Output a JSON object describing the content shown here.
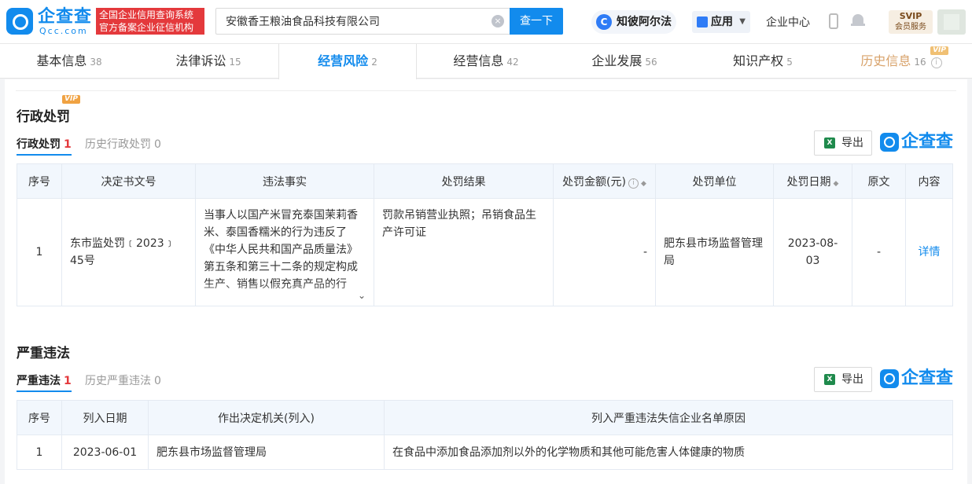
{
  "header": {
    "logo_name": "企查查",
    "logo_domain": "Qcc.com",
    "badge_line1": "全国企业信用查询系统",
    "badge_line2": "官方备案企业征信机构",
    "search_value": "安徽香王粮油食品科技有限公司",
    "search_button": "查一下",
    "zhibi_label": "知彼阿尔法",
    "zhibi_icon_text": "C",
    "apps_label": "应用",
    "enterprise_center": "企业中心",
    "svip_line1": "SVIP",
    "svip_line2": "会员服务"
  },
  "tabs": [
    {
      "label": "基本信息",
      "count": "38"
    },
    {
      "label": "法律诉讼",
      "count": "15"
    },
    {
      "label": "经营风险",
      "count": "2"
    },
    {
      "label": "经营信息",
      "count": "42"
    },
    {
      "label": "企业发展",
      "count": "56"
    },
    {
      "label": "知识产权",
      "count": "5"
    },
    {
      "label": "历史信息",
      "count": "16",
      "badge": "VIP"
    }
  ],
  "admin_penalty": {
    "title": "行政处罚",
    "vip": "VIP",
    "subtab_active": "行政处罚",
    "subtab_active_count": "1",
    "subtab_other": "历史行政处罚",
    "subtab_other_count": "0",
    "export_label": "导出",
    "brand": "企查查",
    "columns": [
      "序号",
      "决定书文号",
      "违法事实",
      "处罚结果",
      "处罚金额(元)",
      "处罚单位",
      "处罚日期",
      "原文",
      "内容"
    ],
    "rows": [
      {
        "index": "1",
        "doc_no": "东市监处罚﹝2023﹞45号",
        "facts": "当事人以国产米冒充泰国茉莉香米、泰国香糯米的行为违反了《中华人民共和国产品质量法》第五条和第三十二条的规定构成生产、销售以假充真产品的行",
        "result": "罚款吊销营业执照；吊销食品生产许可证",
        "amount": "-",
        "unit": "肥东县市场监督管理局",
        "date": "2023-08-03",
        "original": "-",
        "content": "详情"
      }
    ]
  },
  "serious_violation": {
    "title": "严重违法",
    "subtab_active": "严重违法",
    "subtab_active_count": "1",
    "subtab_other": "历史严重违法",
    "subtab_other_count": "0",
    "export_label": "导出",
    "brand": "企查查",
    "columns": [
      "序号",
      "列入日期",
      "作出决定机关(列入)",
      "列入严重违法失信企业名单原因"
    ],
    "rows": [
      {
        "index": "1",
        "date": "2023-06-01",
        "authority": "肥东县市场监督管理局",
        "reason": "在食品中添加食品添加剂以外的化学物质和其他可能危害人体健康的物质"
      }
    ]
  },
  "colors": {
    "primary": "#128bed",
    "danger": "#e4393c",
    "vip": "#f0a242"
  }
}
